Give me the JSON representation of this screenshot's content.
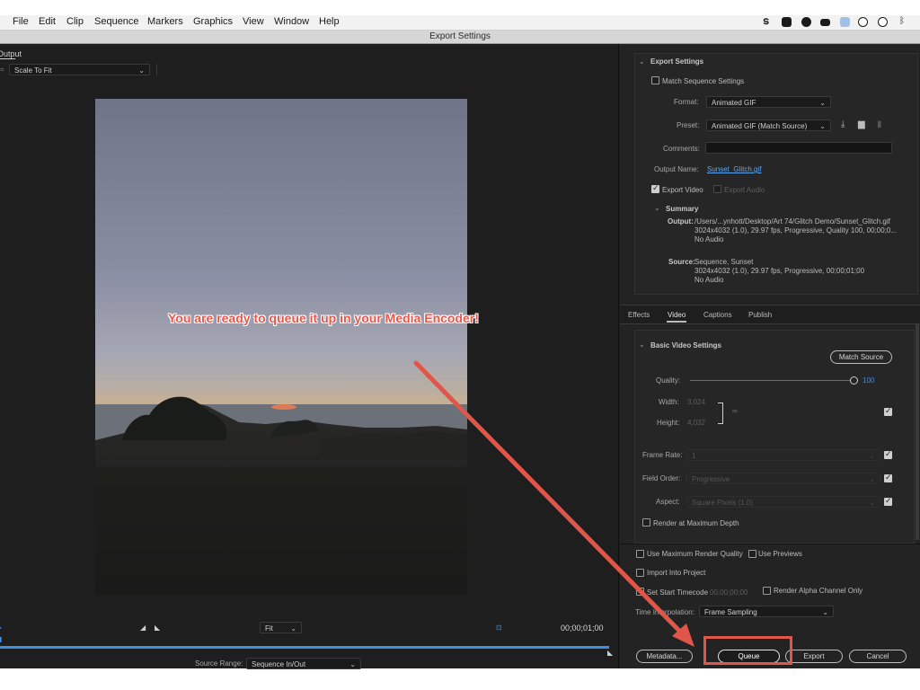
{
  "menubar": {
    "items": [
      "File",
      "Edit",
      "Clip",
      "Sequence",
      "Markers",
      "Graphics",
      "View",
      "Window",
      "Help"
    ]
  },
  "window_title": "Export Settings",
  "left": {
    "tab": "Output",
    "scale_select": "Scale To Fit",
    "annotation": "You are ready to queue it up in your Media Encoder!",
    "fit_select": "Fit",
    "timecode": "00;00;01;00",
    "source_range_label": "Source Range:",
    "source_range_value": "Sequence In/Out"
  },
  "export_settings": {
    "section_title": "Export Settings",
    "match_sequence": "Match Sequence Settings",
    "format_label": "Format:",
    "format_value": "Animated GIF",
    "preset_label": "Preset:",
    "preset_value": "Animated GIF (Match Source)",
    "comments_label": "Comments:",
    "comments_value": "",
    "output_name_label": "Output Name:",
    "output_name_value": "Sunset_Glitch.gif",
    "export_video": "Export Video",
    "export_audio": "Export Audio",
    "summary_title": "Summary",
    "output_label": "Output:",
    "output_lines": [
      "/Users/...ynhott/Desktop/Art 74/Glitch Demo/Sunset_Glitch.gif",
      "3024x4032 (1.0), 29.97 fps, Progressive, Quality 100, 00;00;0...",
      "No Audio"
    ],
    "source_label": "Source:",
    "source_lines": [
      "Sequence, Sunset",
      "3024x4032 (1.0), 29.97 fps, Progressive, 00;00;01;00",
      "No Audio"
    ]
  },
  "tabs": [
    "Effects",
    "Video",
    "Captions",
    "Publish"
  ],
  "active_tab": "Video",
  "video": {
    "section_title": "Basic Video Settings",
    "match_source": "Match Source",
    "quality_label": "Quality:",
    "quality_value": "100",
    "quality_level": 1.0,
    "width_label": "Width:",
    "width_value": "3,024",
    "height_label": "Height:",
    "height_value": "4,032",
    "frame_rate_label": "Frame Rate:",
    "frame_rate_value": "1",
    "field_order_label": "Field Order:",
    "field_order_value": "Progressive",
    "aspect_label": "Aspect:",
    "aspect_value": "Square Pixels (1.0)",
    "render_max_depth": "Render at Maximum Depth"
  },
  "bottom": {
    "use_max_render": "Use Maximum Render Quality",
    "use_previews": "Use Previews",
    "import_into_project": "Import Into Project",
    "set_start_timecode": "Set Start Timecode",
    "start_timecode_value": "00;00;00;00",
    "render_alpha": "Render Alpha Channel Only",
    "time_interp_label": "Time Interpolation:",
    "time_interp_value": "Frame Sampling",
    "metadata_button": "Metadata...",
    "queue_button": "Queue",
    "export_button": "Export",
    "cancel_button": "Cancel"
  },
  "colors": {
    "accent_blue": "#3d8fe0",
    "annotation_red": "#e0564a",
    "panel_bg": "#232323"
  }
}
